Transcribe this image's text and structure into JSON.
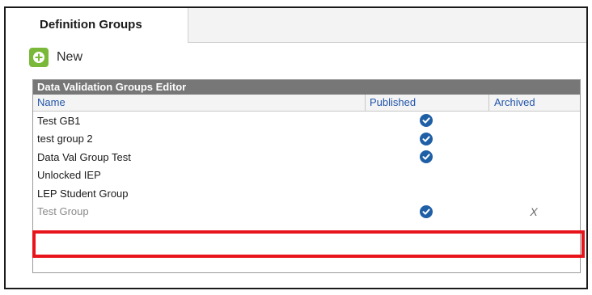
{
  "tabs": [
    {
      "label": "Definition Groups",
      "active": true
    }
  ],
  "toolbar": {
    "new_label": "New",
    "new_icon": "plus-circle-icon"
  },
  "editor": {
    "title": "Data Validation Groups Editor",
    "columns": {
      "name": "Name",
      "published": "Published",
      "archived": "Archived"
    },
    "rows": [
      {
        "name": "Test GB1",
        "published": true,
        "archived": false
      },
      {
        "name": "test group 2",
        "published": true,
        "archived": false
      },
      {
        "name": "Data Val Group Test",
        "published": true,
        "archived": false
      },
      {
        "name": "Unlocked IEP",
        "published": false,
        "archived": false
      },
      {
        "name": "LEP Student Group",
        "published": false,
        "archived": false
      },
      {
        "name": "Test Group",
        "published": true,
        "archived": true,
        "archived_mark": "X",
        "highlighted": true
      }
    ]
  },
  "colors": {
    "highlight": "#e8141c",
    "check": "#1f5fa6",
    "plus": "#7ab83a",
    "header_bar": "#777777"
  }
}
